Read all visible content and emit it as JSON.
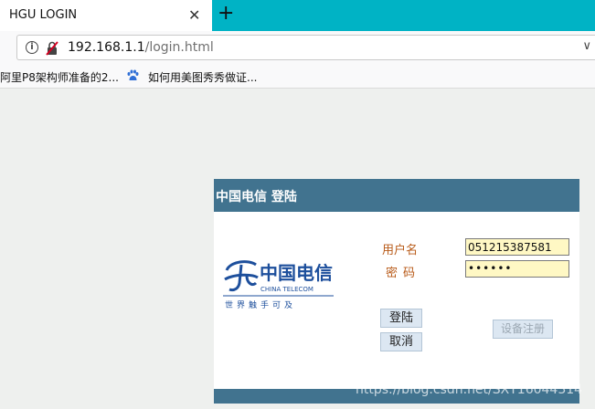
{
  "browser": {
    "tab_title": "HGU LOGIN",
    "close_glyph": "✕",
    "new_tab_glyph": "+",
    "url_host": "192.168.1.1",
    "url_path": "/login.html",
    "dropdown_glyph": "∨",
    "bookmarks": [
      {
        "label": "阿里P8架构师准备的2..."
      },
      {
        "label": "如何用美图秀秀做证..."
      }
    ]
  },
  "login": {
    "title": "中国电信 登陆",
    "logo_cn": "中国电信",
    "logo_en": "CHINA TELECOM",
    "logo_slogan": "世界触手可及",
    "username_label": "用户名",
    "password_label": "密码",
    "username_value": "051215387581",
    "password_value": "••••••",
    "login_button": "登陆",
    "cancel_button": "取消",
    "register_button": "设备注册"
  },
  "watermark": "https://blog.csdn.net/SXY16044314",
  "colors": {
    "tab_strip": "#00b3c5",
    "panel_header": "#41738f",
    "label_text": "#b85a18",
    "input_bg": "#fff8c4",
    "button_bg": "#dce7f2",
    "logo_blue": "#1d4f9c"
  }
}
